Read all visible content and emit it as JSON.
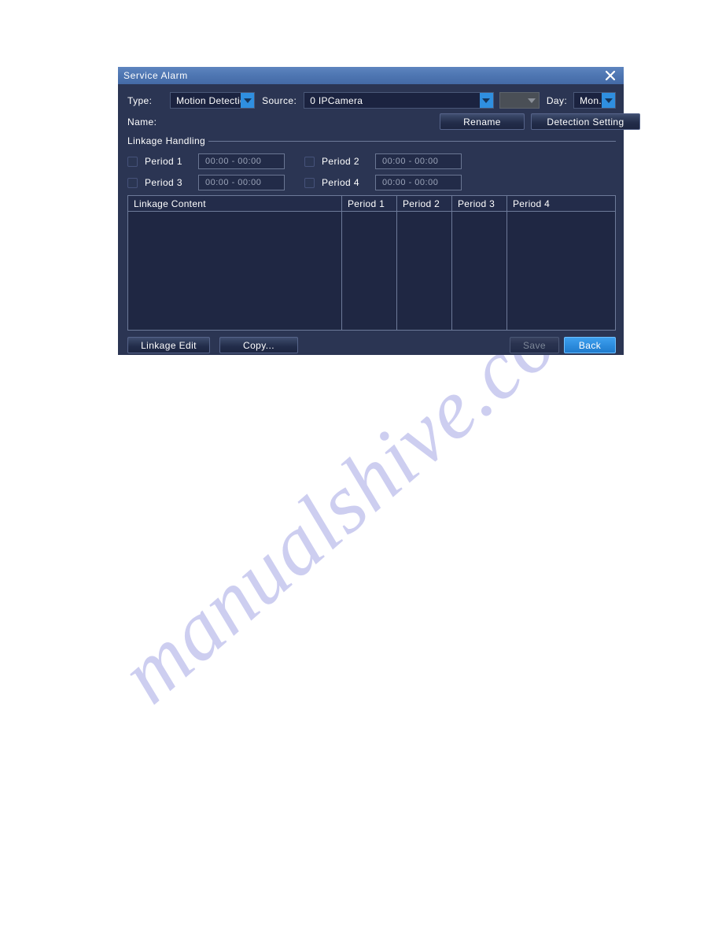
{
  "watermark": {
    "text": "manualshive.com"
  },
  "dialog": {
    "title": "Service Alarm",
    "close_icon": "close-icon",
    "fields": {
      "type_label": "Type:",
      "type_value": "Motion Detectio",
      "source_label": "Source:",
      "source_value": "0 IPCamera",
      "channel_value": "",
      "day_label": "Day:",
      "day_value": "Mon.",
      "name_label": "Name:",
      "name_value": ""
    },
    "buttons": {
      "rename": "Rename",
      "detection_setting": "Detection Setting",
      "linkage_edit": "Linkage Edit",
      "copy": "Copy...",
      "save": "Save",
      "back": "Back"
    },
    "group": {
      "legend": "Linkage Handling",
      "periods": [
        {
          "label": "Period 1",
          "checked": false,
          "time": "00:00  -  00:00"
        },
        {
          "label": "Period 2",
          "checked": false,
          "time": "00:00  -  00:00"
        },
        {
          "label": "Period 3",
          "checked": false,
          "time": "00:00  -  00:00"
        },
        {
          "label": "Period 4",
          "checked": false,
          "time": "00:00  -  00:00"
        }
      ]
    },
    "table": {
      "headers": [
        "Linkage Content",
        "Period 1",
        "Period 2",
        "Period 3",
        "Period 4"
      ],
      "rows": []
    },
    "colors": {
      "titlebar": "#4f77b3",
      "dialog_bg": "#2b3553",
      "accent": "#2f8fe0",
      "field_bg": "#1b2340",
      "border": "#6d7a99",
      "disabled_text": "#7d8798"
    }
  }
}
